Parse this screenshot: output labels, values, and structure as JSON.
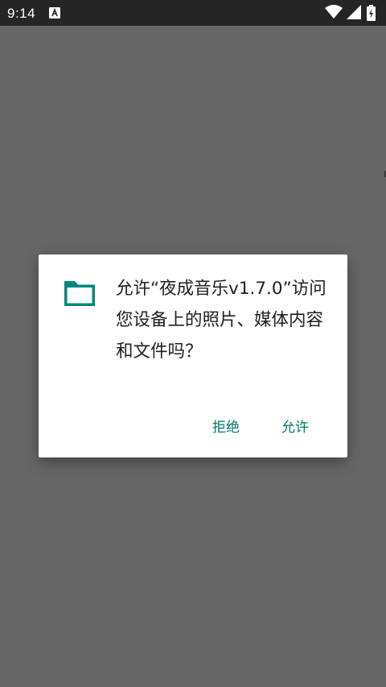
{
  "status_bar": {
    "time": "9:14",
    "notification_icon": "app-notification-icon",
    "wifi_icon": "wifi-icon",
    "signal_icon": "cell-signal-icon",
    "battery_icon": "battery-charging-icon"
  },
  "dialog": {
    "icon": "folder-icon",
    "message": "允许“夜成音乐v1.7.0”访问您设备上的照片、媒体内容和文件吗？",
    "deny_label": "拒绝",
    "allow_label": "允许"
  },
  "colors": {
    "scrim": "#666666",
    "status_bar": "#252525",
    "accent": "#00796b",
    "dialog_bg": "#ffffff"
  }
}
